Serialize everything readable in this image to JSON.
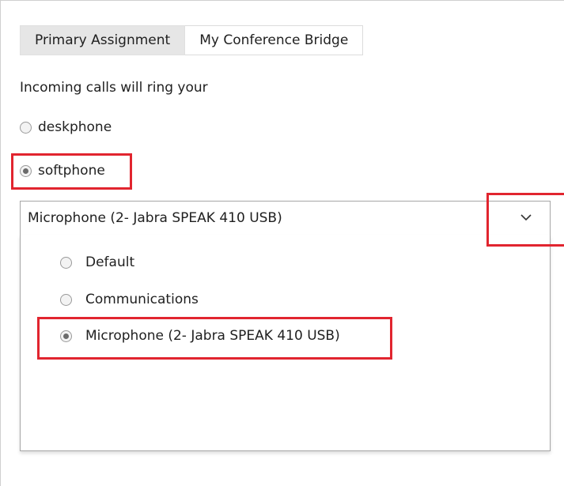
{
  "tabs": [
    {
      "label": "Primary Assignment",
      "active": true
    },
    {
      "label": "My Conference Bridge",
      "active": false
    }
  ],
  "prompt": "Incoming calls will ring your",
  "ring_options": [
    {
      "label": "deskphone",
      "selected": false
    },
    {
      "label": "softphone",
      "selected": true
    }
  ],
  "microphone_select": {
    "value": "Microphone (2- Jabra SPEAK 410 USB)",
    "arrow_icon": "chevron-down-icon",
    "options": [
      {
        "label": "Default",
        "selected": false
      },
      {
        "label": "Communications",
        "selected": false
      },
      {
        "label": "Microphone (2- Jabra SPEAK 410 USB)",
        "selected": true
      }
    ]
  },
  "colors": {
    "highlight": "#e1252f",
    "active_tab_bg": "#e6e6e6",
    "border": "#a6a6a6"
  }
}
